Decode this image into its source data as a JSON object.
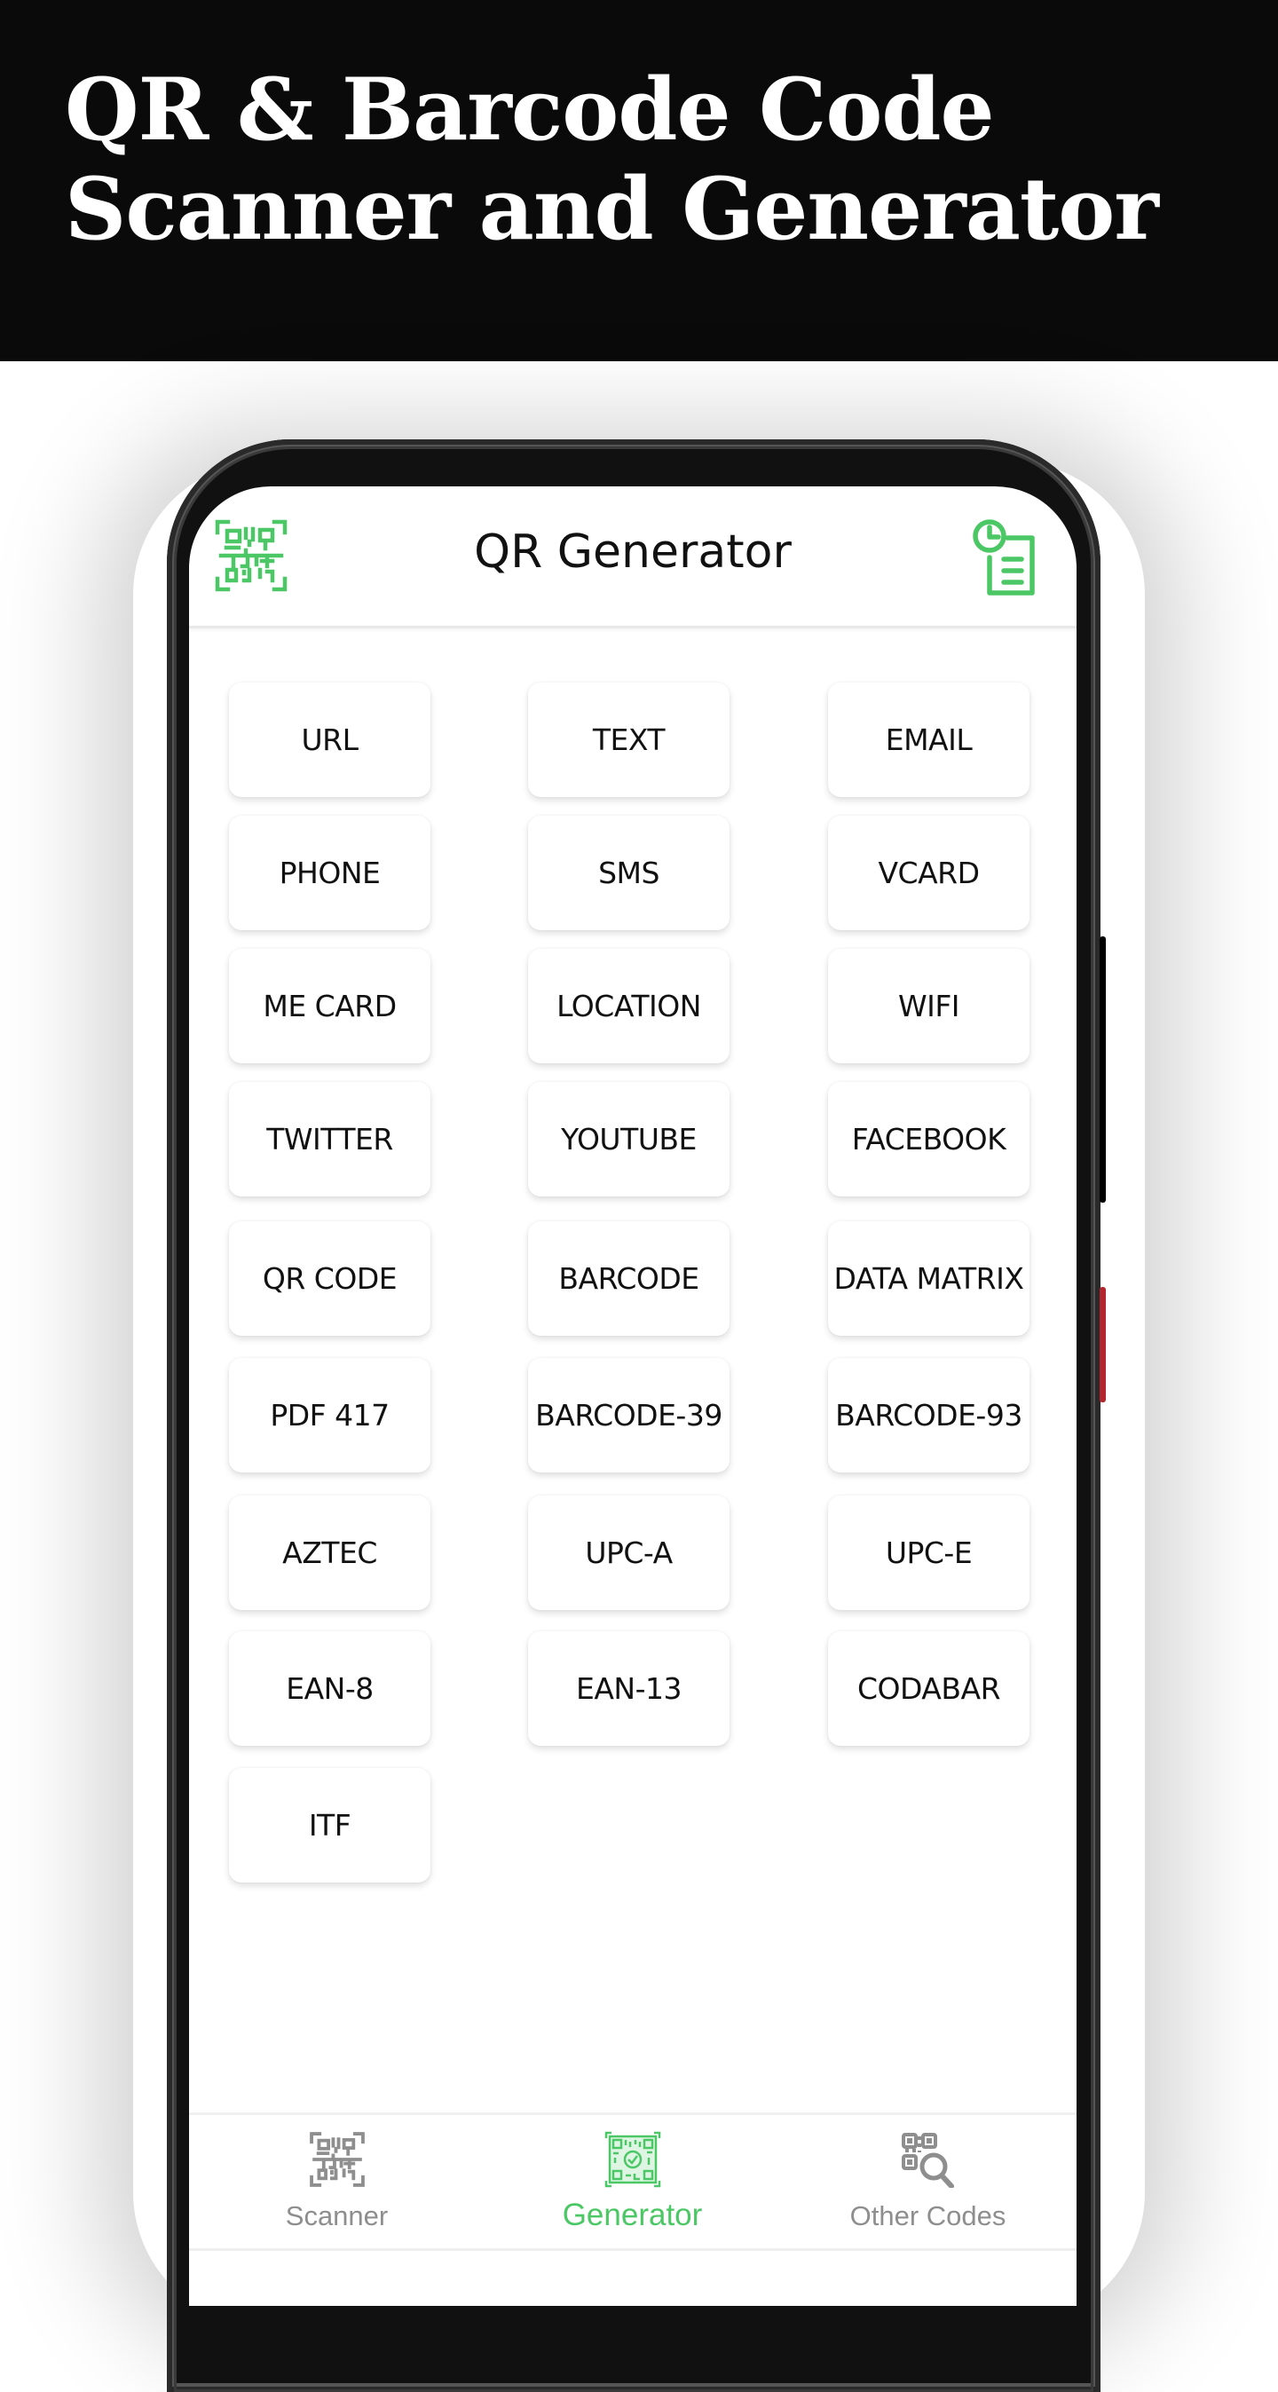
{
  "banner": {
    "title_line1": "QR & Barcode Code",
    "title_line2": "Scanner and Generator"
  },
  "app": {
    "title": "QR Generator",
    "accent_color": "#4cc765",
    "inactive_color": "#8e8e8e",
    "header_left_icon": "qr-scan-icon",
    "header_right_icon": "history-icon"
  },
  "code_types": [
    "URL",
    "TEXT",
    "EMAIL",
    "PHONE",
    "SMS",
    "VCARD",
    "ME CARD",
    "LOCATION",
    "WIFI",
    "TWITTER",
    "YOUTUBE",
    "FACEBOOK",
    "QR CODE",
    "BARCODE",
    "DATA MATRIX",
    "PDF 417",
    "BARCODE-39",
    "BARCODE-93",
    "AZTEC",
    "UPC-A",
    "UPC-E",
    "EAN-8",
    "EAN-13",
    "CODABAR",
    "ITF"
  ],
  "bottom_nav": {
    "items": [
      {
        "label": "Scanner",
        "icon": "qr-scan-icon",
        "active": false
      },
      {
        "label": "Generator",
        "icon": "qr-generate-icon",
        "active": true
      },
      {
        "label": "Other Codes",
        "icon": "qr-search-icon",
        "active": false
      }
    ]
  }
}
